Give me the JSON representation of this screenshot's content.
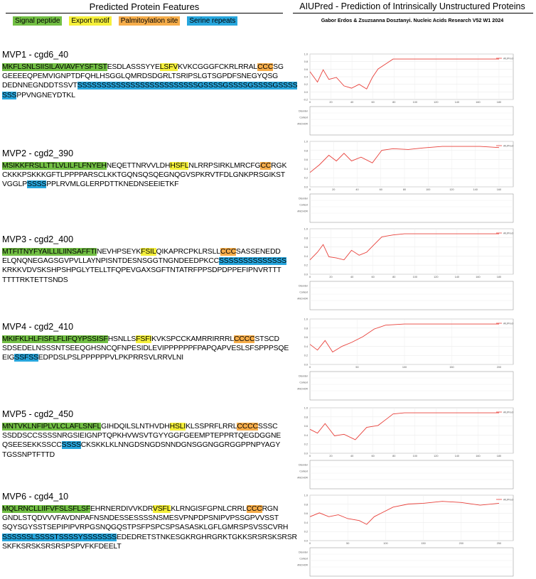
{
  "header": {
    "left_title": "Predicted Protein Features",
    "right_title": "AIUPred - Prediction of Intrinsically Unstructured Proteins",
    "citation": "Gabor Erdos & Zsuzsanna Dosztanyi. Nucleic Acids Research V52 W1 2024"
  },
  "legend": {
    "items": [
      {
        "label": "Signal peptide",
        "color": "#72bf44"
      },
      {
        "label": "Export motif",
        "color": "#f5f03a"
      },
      {
        "label": "Palmitoylation site",
        "color": "#f6ad4a"
      },
      {
        "label": "Serine repeats",
        "color": "#27a6dd"
      }
    ]
  },
  "proteins": [
    {
      "name": "MVP1 - cgd6_40",
      "lines": [
        [
          [
            "MKFLSNLSIISILAVIAVFYSFTST",
            "sig"
          ],
          [
            "ESDLASSSYYE",
            ""
          ],
          [
            "LSFV",
            "exp"
          ],
          [
            "KVKCGGGFCKRLRRAL",
            ""
          ],
          [
            "CCC",
            "pal"
          ],
          [
            "SG",
            ""
          ]
        ],
        [
          [
            "GEEEEQPEMVIGNPTDFQHLHSGGLQMRDSDGRLTSRIPSLGTSGPDFSNEGYQSG",
            ""
          ]
        ],
        [
          [
            "DEDNNEGNDDTSSVT",
            ""
          ],
          [
            "SSSSSSSSSSSSSSSSSSSSSSSSSGSSSSGSSSSGSSSSGSSSS",
            "ser"
          ]
        ],
        [
          [
            "SSS",
            "ser"
          ],
          [
            "PPVNGNEYDTKL",
            ""
          ]
        ]
      ]
    },
    {
      "name": "MVP2 - cgd2_390",
      "lines": [
        [
          [
            "MSIKKFRSLLTTLVLILFLFNYEH",
            "sig"
          ],
          [
            "NEQETTNRVVLDH",
            ""
          ],
          [
            "HSFL",
            "exp"
          ],
          [
            "NLRRPSIRKLMRCFG",
            ""
          ],
          [
            "CC",
            "pal"
          ],
          [
            "RGK",
            ""
          ]
        ],
        [
          [
            "CKKKPSKKKGFTLPPPPARSCLKKTGQNSQSQEGNQGVSPKRVTFDLGNKPRSGIKST",
            ""
          ]
        ],
        [
          [
            "VGGLP",
            ""
          ],
          [
            "SSSS",
            "ser"
          ],
          [
            "PPLRVMLGLERPDTTKNEDNSEEIETKF",
            ""
          ]
        ]
      ]
    },
    {
      "name": "MVP3 - cgd2_400",
      "lines": [
        [
          [
            "MTFITNYFYAILLILIINSAFFTI",
            "sig"
          ],
          [
            "NEVHPSEYK",
            ""
          ],
          [
            "FSIL",
            "exp"
          ],
          [
            "QIKAPRCPKLRSLL",
            ""
          ],
          [
            "CCC",
            "pal"
          ],
          [
            "SASSENEDD",
            ""
          ]
        ],
        [
          [
            "ELQNQNEGAGSGVPVLLAYNPISNTDESNSGGTNGNDEEDPKCC",
            ""
          ],
          [
            "SSSSSSSSSSSSSS",
            "ser"
          ]
        ],
        [
          [
            "KRKKVDVSKSHPSHPGLYTELLTFQPEVGAXSGFTNTATRFPPSDPDPPEFIPNVRTTT",
            ""
          ]
        ],
        [
          [
            "TTTTRKTETTSNDS",
            ""
          ]
        ]
      ]
    },
    {
      "name": "MVP4 - cgd2_410",
      "lines": [
        [
          [
            "MKIFKLHLFISFLFLIFQYPSSISF",
            "sig"
          ],
          [
            "HSNLLS",
            ""
          ],
          [
            "FSFI",
            "exp"
          ],
          [
            "KVKSPCCKAMRRIRRRL",
            ""
          ],
          [
            "CCCC",
            "pal"
          ],
          [
            "STSCD",
            ""
          ]
        ],
        [
          [
            "SDSEDELNSSSNTSEEQGHSNCQFNPESIDLEVIPPPPPPFPAPQAPVESLSFSPPPSQE",
            ""
          ]
        ],
        [
          [
            "EIG",
            ""
          ],
          [
            "SSFSS",
            "ser"
          ],
          [
            "EDPDSLPSLPPPPPPVLPKPRRSVLRRVLNI",
            ""
          ]
        ]
      ]
    },
    {
      "name": "MVP5 - cgd2_450",
      "lines": [
        [
          [
            "MNTVKLNFIPLVLCLAFLSNFL",
            "sig"
          ],
          [
            "GIHDQILSLNTHVDH",
            ""
          ],
          [
            "HSLI",
            "exp"
          ],
          [
            "KLSSPRFLRRL",
            ""
          ],
          [
            "CCCC",
            "pal"
          ],
          [
            "SSSC",
            ""
          ]
        ],
        [
          [
            "SSDDSCCSSSSNRGSIEIGNPTQPKHVWSVTGYYGGFGEEMPTEPPRTQEGDGGNE",
            ""
          ]
        ],
        [
          [
            "QSEESEKKSSCC",
            ""
          ],
          [
            "SSSS",
            "ser"
          ],
          [
            "CKSKKLKLNNGDSNGDSNNDGNSGGNGGRGGPPNPYAGY",
            ""
          ]
        ],
        [
          [
            "TGSSNPTFTTD",
            ""
          ]
        ]
      ]
    },
    {
      "name": "MVP6 - cgd4_10",
      "lines": [
        [
          [
            "MQLRNCLLIIFVFSLSFLSF",
            "sig"
          ],
          [
            "EHRNERDIVVKDR",
            ""
          ],
          [
            "VSFL",
            "exp"
          ],
          [
            "KLRNGISFGPNLCRRL",
            ""
          ],
          [
            "CCC",
            "pal"
          ],
          [
            "RGN",
            ""
          ]
        ],
        [
          [
            "GNDLSTQDVVVFAVDNPAFNSNDESSESSSSNSMESVPNPDPSNIPVPSSGPVVSST",
            ""
          ]
        ],
        [
          [
            "SQYSGYSSTSEPIPIPVRPGSNQGQSTPSFPSPCSPSASASKLGFLGMRSPSVSSCVRH",
            ""
          ]
        ],
        [
          [
            "SSSSSSLSSSSTSSSSYSSSSSSS",
            "ser"
          ],
          [
            "EDEDRETSTNKESGKRGHRGRKTGKKSRSRSKSRSR",
            ""
          ]
        ],
        [
          [
            "SKFKSRSKSRSRSPSPVFKFDEELT",
            ""
          ]
        ]
      ]
    }
  ],
  "plots": [
    {
      "legend": "AIUPred",
      "ylabels": [
        "1.0",
        "0.8",
        "0.6",
        "0.4",
        "0.2",
        "0.0",
        "-0.2"
      ],
      "xlabels": [
        "0",
        "20",
        "40",
        "60",
        "80",
        "100",
        "120",
        "140",
        "160",
        "180"
      ],
      "track_labels": [
        "Disorder",
        "Context",
        "ANCHOR"
      ]
    },
    {
      "legend": "AIUPred",
      "ylabels": [
        "1.0",
        "0.8",
        "0.6",
        "0.4",
        "0.2",
        "0.0"
      ],
      "xlabels": [
        "0",
        "20",
        "40",
        "60",
        "80",
        "100",
        "120",
        "140",
        "160"
      ],
      "track_labels": [
        "Disorder",
        "Context",
        "ANCHOR"
      ]
    },
    {
      "legend": "AIUPred",
      "ylabels": [
        "1.0",
        "0.8",
        "0.6",
        "0.4",
        "0.2",
        "0.0"
      ],
      "xlabels": [
        "0",
        "20",
        "40",
        "60",
        "80",
        "100",
        "120",
        "140",
        "160",
        "180"
      ],
      "track_labels": [
        "Disorder",
        "Context",
        "ANCHOR"
      ]
    },
    {
      "legend": "AIUPred",
      "ylabels": [
        "1.0",
        "0.8",
        "0.6",
        "0.4",
        "0.2",
        "0.0"
      ],
      "xlabels": [
        "0",
        "50",
        "100",
        "150",
        "200"
      ],
      "track_labels": [
        "Disorder",
        "Context",
        "ANCHOR"
      ]
    },
    {
      "legend": "AIUPred",
      "ylabels": [
        "1.0",
        "0.8",
        "0.6",
        "0.4",
        "0.2",
        "0.0"
      ],
      "xlabels": [
        "0",
        "20",
        "40",
        "60",
        "80",
        "100",
        "120",
        "140",
        "160",
        "180"
      ],
      "track_labels": [
        "Disorder",
        "Context",
        "ANCHOR"
      ]
    },
    {
      "legend": "AIUPred",
      "ylabels": [
        "1.0",
        "0.8",
        "0.6",
        "0.4",
        "0.2",
        "0.0"
      ],
      "xlabels": [
        "0",
        "50",
        "100",
        "150",
        "200",
        "250"
      ],
      "track_labels": [
        "Disorder",
        "Context",
        "ANCHOR"
      ]
    }
  ]
}
